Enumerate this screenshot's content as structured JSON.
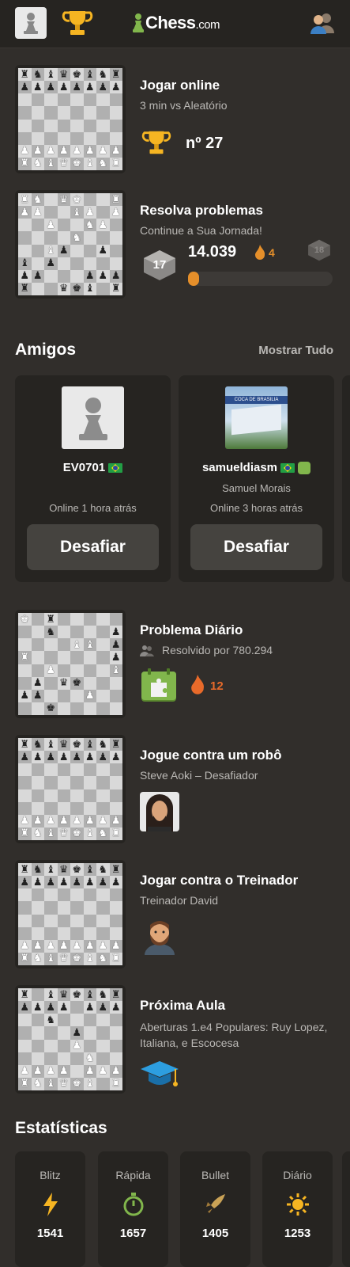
{
  "header": {
    "logo_main": "Chess",
    "logo_com": ".com"
  },
  "colors": {
    "background": "#312e2b",
    "card": "#262421",
    "accent_orange": "#e58f2a",
    "gold": "#f6b522",
    "green": "#81b64c"
  },
  "play_online": {
    "title": "Jogar online",
    "subtitle": "3 min vs Aleatório",
    "rank": "nº 27"
  },
  "puzzles": {
    "title": "Resolva problemas",
    "subtitle": "Continue a Sua Jornada!",
    "level": "17",
    "score": "14.039",
    "streak": "4",
    "next_level": "18",
    "progress": 0.04
  },
  "friends_section": {
    "title": "Amigos",
    "show_all": "Mostrar Tudo",
    "friends": [
      {
        "username": "EV0701",
        "real_name": "",
        "online": "Online 1 hora atrás",
        "button": "Desafiar"
      },
      {
        "username": "samueldiasm",
        "real_name": "Samuel Morais",
        "online": "Online 3 horas atrás",
        "button": "Desafiar",
        "avatar_text": "COCA DE BRASILIA"
      }
    ]
  },
  "daily_puzzle": {
    "title": "Problema Diário",
    "subtitle": "Resolvido por 780.294",
    "streak": "12"
  },
  "bot": {
    "title": "Jogue contra um robô",
    "subtitle": "Steve Aoki – Desafiador"
  },
  "coach": {
    "title": "Jogar contra o Treinador",
    "subtitle": "Treinador David"
  },
  "lesson": {
    "title": "Próxima Aula",
    "subtitle": "Aberturas 1.e4 Populares: Ruy Lopez, Italiana, e Escocesa"
  },
  "stats": {
    "title": "Estatísticas",
    "items": [
      {
        "label": "Blitz",
        "value": "1541",
        "icon": "lightning-icon",
        "color": "#f6b522"
      },
      {
        "label": "Rápida",
        "value": "1657",
        "icon": "stopwatch-icon",
        "color": "#81b64c"
      },
      {
        "label": "Bullet",
        "value": "1405",
        "icon": "bullet-icon",
        "color": "#c9a256"
      },
      {
        "label": "Diário",
        "value": "1253",
        "icon": "sun-icon",
        "color": "#f6b522"
      }
    ]
  },
  "boards": {
    "play_online": [
      "rnbqkbnr",
      "pppppppp",
      "........",
      "........",
      "........",
      "........",
      "PPPPPPPP",
      "RNBQKBNR"
    ],
    "puzzles": [
      "RN.QK..R",
      "PP..BP.P",
      "..P..NP.",
      "....N...",
      "..Bp..p.",
      "b.p.....",
      "pp...ppp",
      "r..qkb.r"
    ],
    "daily": [
      "K.r.....",
      "..n....p",
      "....BB.p",
      "R......p",
      "..P....B",
      ".p.qk...",
      "pp...P..",
      "..k....."
    ],
    "bot": [
      "rnbqkbnr",
      "pppppppp",
      "........",
      "........",
      "........",
      "........",
      "PPPPPPPP",
      "RNBQKBNR"
    ],
    "coach": [
      "rnbqkbnr",
      "pppppppp",
      "........",
      "........",
      "........",
      "........",
      "PPPPPPPP",
      "RNBQKBNR"
    ],
    "lesson": [
      "r.bqkbnr",
      "pppp.ppp",
      "..n.....",
      "....p...",
      "....P...",
      ".....N..",
      "PPPP.PPP",
      "RNBQKB.R"
    ]
  }
}
